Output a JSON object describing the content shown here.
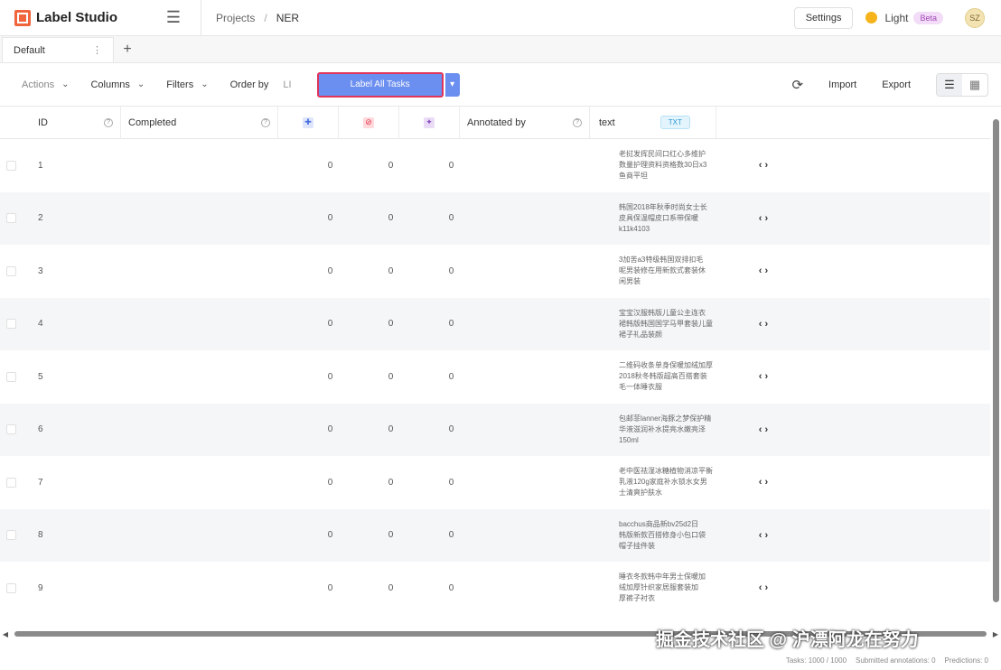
{
  "header": {
    "app_name": "Label Studio",
    "breadcrumb": [
      "Projects",
      "NER"
    ],
    "settings_label": "Settings",
    "theme_label": "Light",
    "beta_label": "Beta",
    "avatar_initials": "SZ"
  },
  "tabs": [
    {
      "label": "Default"
    }
  ],
  "toolbar": {
    "actions_label": "Actions",
    "columns_label": "Columns",
    "filters_label": "Filters",
    "order_by_label": "Order by",
    "order_toggle": "LI",
    "label_all_label": "Label All Tasks",
    "import_label": "Import",
    "export_label": "Export"
  },
  "table": {
    "columns": {
      "id": "ID",
      "completed": "Completed",
      "annotated_by": "Annotated by",
      "text": "text",
      "text_badge": "TXT"
    },
    "rows": [
      {
        "id": "1",
        "annotations": "0",
        "skipped": "0",
        "predictions": "0",
        "text": [
          "老挝发挥民间口红心多维护",
          "数量护理资料资格数30日x3",
          "鱼商平坦"
        ]
      },
      {
        "id": "2",
        "annotations": "0",
        "skipped": "0",
        "predictions": "0",
        "text": [
          "韩国2018年秋季时尚女士长",
          "皮具保温帽皮口系带保暖",
          "k11k4103"
        ]
      },
      {
        "id": "3",
        "annotations": "0",
        "skipped": "0",
        "predictions": "0",
        "text": [
          "3加苦a3特级韩国双排扣毛",
          "呢男装修在用新款式套装休",
          "闲男装"
        ]
      },
      {
        "id": "4",
        "annotations": "0",
        "skipped": "0",
        "predictions": "0",
        "text": [
          "宝宝汉服韩版儿童公主连衣",
          "裙韩版韩国国学马甲套装儿童",
          "裙子礼品装颜"
        ]
      },
      {
        "id": "5",
        "annotations": "0",
        "skipped": "0",
        "predictions": "0",
        "text": [
          "二维码收条单身保暖加绒加厚",
          "2018秋冬韩版超高百搭套装",
          "毛一体睡衣服"
        ]
      },
      {
        "id": "6",
        "annotations": "0",
        "skipped": "0",
        "predictions": "0",
        "text": [
          "包邮菲lanner海豚之梦保护精",
          "华液滋润补水提亮水嫩亮泽",
          "150ml"
        ]
      },
      {
        "id": "7",
        "annotations": "0",
        "skipped": "0",
        "predictions": "0",
        "text": [
          "老中医祛湿冰糖植物消凉平衡",
          "乳液120g家庭补水锁水女男",
          "士清爽护肤水"
        ]
      },
      {
        "id": "8",
        "annotations": "0",
        "skipped": "0",
        "predictions": "0",
        "text": [
          "bacchus商品新bv25d2日",
          "韩版新款百搭修身小包口袋",
          "帽子挂件装"
        ]
      },
      {
        "id": "9",
        "annotations": "0",
        "skipped": "0",
        "predictions": "0",
        "text": [
          "睡衣冬款韩中年男士保暖加",
          "绒加厚针织家居服套装加",
          "厚裤子衬衣"
        ]
      }
    ]
  },
  "footer": {
    "tasks": "Tasks: 1000 / 1000",
    "submitted": "Submitted annotations: 0",
    "predictions": "Predictions: 0"
  },
  "watermark": "掘金技术社区 @ 沪漂阿龙在努力"
}
